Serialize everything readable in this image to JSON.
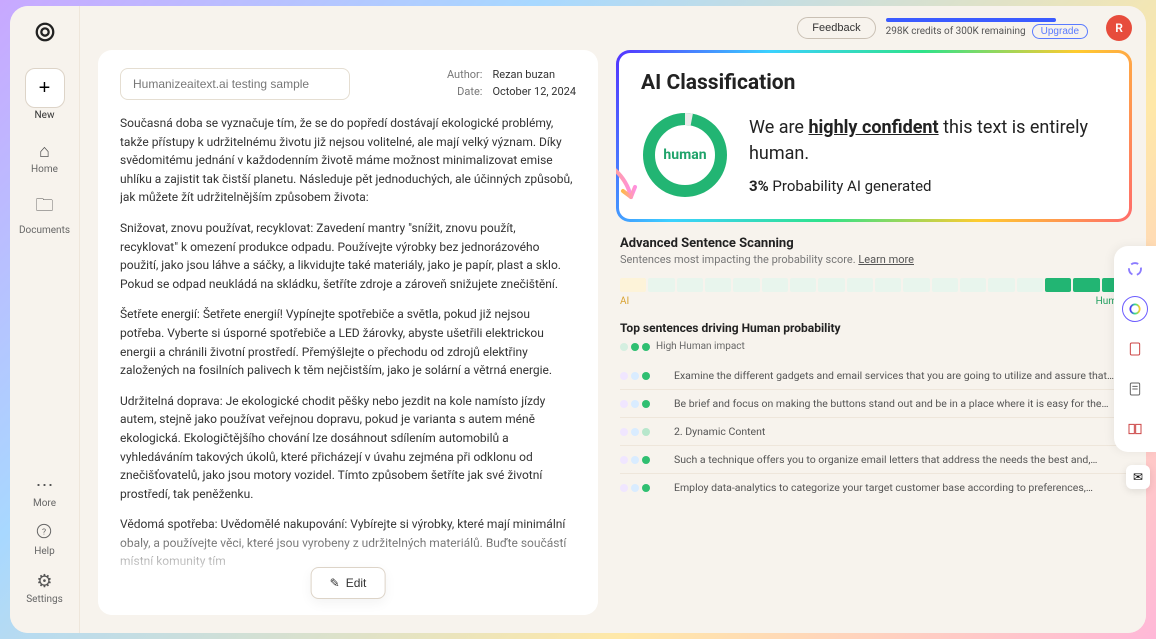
{
  "sidebar": {
    "new_label": "New",
    "items": [
      {
        "icon": "home-icon",
        "glyph": "⌂",
        "label": "Home"
      },
      {
        "icon": "documents-icon",
        "glyph": "🗀",
        "label": "Documents"
      }
    ],
    "bottom": [
      {
        "icon": "more-icon",
        "glyph": "⋯",
        "label": "More"
      },
      {
        "icon": "help-icon",
        "glyph": "?",
        "label": "Help"
      },
      {
        "icon": "settings-icon",
        "glyph": "⚙",
        "label": "Settings"
      }
    ]
  },
  "topbar": {
    "feedback": "Feedback",
    "credits": "298K credits of 300K remaining",
    "upgrade": "Upgrade",
    "avatar_initial": "R"
  },
  "document": {
    "title": "Humanizeaitext.ai testing sample",
    "author_label": "Author:",
    "author": "Rezan buzan",
    "date_label": "Date:",
    "date": "October 12, 2024",
    "edit_label": "Edit",
    "paragraphs": [
      "Současná doba se vyznačuje tím, že se do popředí dostávají ekologické problémy, takže přístupy k udržitelnému životu již nejsou volitelné, ale mají velký význam. Díky svědomitému jednání v každodenním životě máme možnost minimalizovat emise uhlíku a zajistit tak čistší planetu. Následuje pět jednoduchých, ale účinných způsobů, jak můžete žít udržitelnějším způsobem života:",
      "Snižovat, znovu používat, recyklovat: Zavedení mantry \"snížit, znovu použít, recyklovat\" k omezení produkce odpadu. Používejte výrobky bez jednorázového použití, jako jsou láhve a sáčky, a likvidujte také materiály, jako je papír, plast a sklo. Pokud se odpad neukládá na skládku, šetříte zdroje a zároveň snižujete znečištění.",
      "Šetřete energií: Šetřete energií! Vypínejte spotřebiče a světla, pokud již nejsou potřeba. Vyberte si úsporné spotřebiče a LED žárovky, abyste ušetřili elektrickou energii a chránili životní prostředí. Přemýšlejte o přechodu od zdrojů elektřiny založených na fosilních palivech k těm nejčistším, jako je solární a větrná energie.",
      "Udržitelná doprava: Je ekologické chodit pěšky nebo jezdit na kole namísto jízdy autem, stejně jako používat veřejnou dopravu, pokud je varianta s autem méně ekologická. Ekologičtějšího chování lze dosáhnout sdílením automobilů a vyhledáváním takových úkolů, které přicházejí v úvahu zejména při odklonu od znečišťovatelů, jako jsou motory vozidel. Tímto způsobem šetříte jak své životní prostředí, tak peněženku.",
      "Vědomá spotřeba: Uvědomělé nakupování: Vybírejte si výrobky, které mají minimální obaly, a používejte věci, které jsou vyrobeny z udržitelných materiálů. Buďte součástí místní komunity tím"
    ]
  },
  "classification": {
    "title": "AI Classification",
    "donut_label": "human",
    "confidence_prefix": "We are ",
    "confidence_highlight": "highly confident",
    "confidence_suffix": " this text is entirely human.",
    "prob_pct": "3%",
    "prob_suffix": " Probability AI generated",
    "colors": {
      "human": "#22b573",
      "ai": "#d9a333"
    }
  },
  "advanced": {
    "title": "Advanced Sentence Scanning",
    "subtitle": "Sentences most impacting the probability score. ",
    "learn_more": "Learn more",
    "ai_label": "AI",
    "human_label": "Human",
    "top_title": "Top sentences driving Human probability",
    "impact_label": "High Human impact",
    "sentences": [
      "Examine the different gadgets and email services that you are going to utilize and assure that…",
      "Be brief and focus on making the buttons stand out and be in a place where it is easy for the…",
      "2. Dynamic Content",
      "Such a technique offers you to organize email letters that address the needs the best and,…",
      "Employ data-analytics to categorize your target customer base according to preferences,…"
    ]
  },
  "chart_data": {
    "type": "pie",
    "title": "AI Classification",
    "categories": [
      "Human",
      "AI"
    ],
    "values": [
      97,
      3
    ],
    "colors": [
      "#22b573",
      "#e6e6e6"
    ]
  },
  "rail": {
    "icons": [
      {
        "name": "spinner-icon",
        "glyph": "◌"
      },
      {
        "name": "ai-color-icon",
        "glyph": "◉"
      },
      {
        "name": "file-icon",
        "glyph": "📄"
      },
      {
        "name": "note-icon",
        "glyph": "📝"
      },
      {
        "name": "book-icon",
        "glyph": "📖"
      }
    ]
  }
}
